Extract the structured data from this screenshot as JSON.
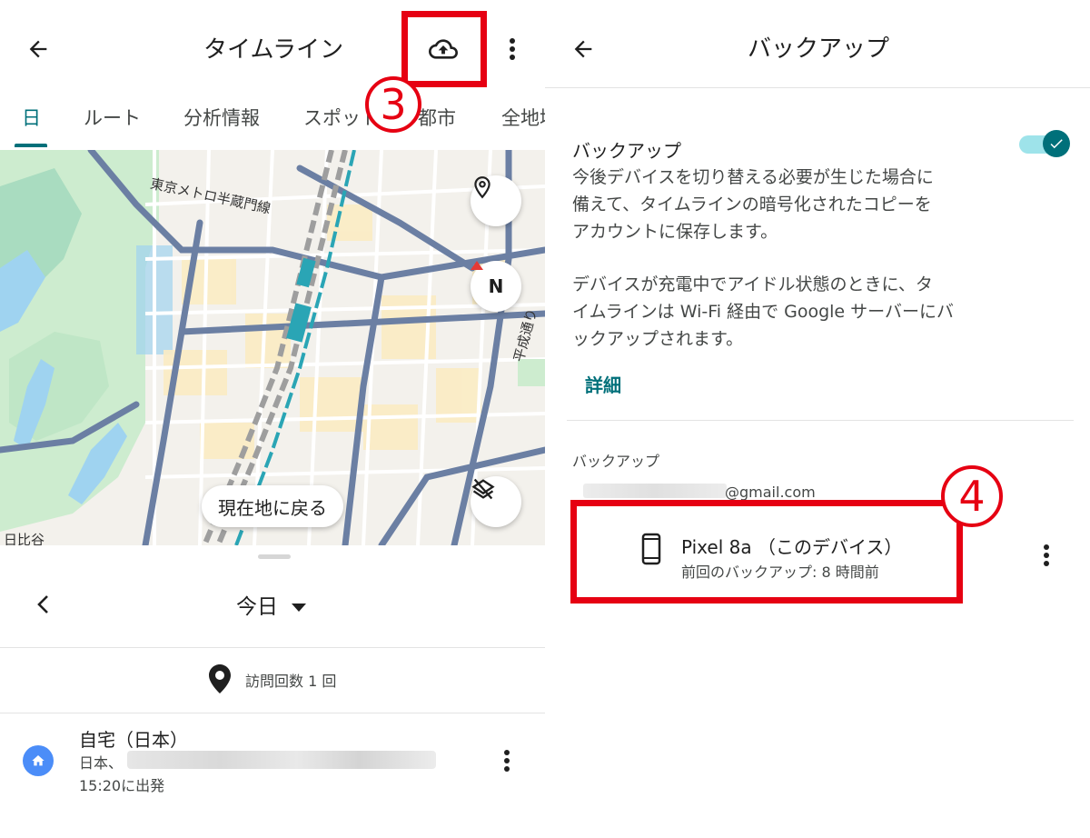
{
  "left": {
    "title": "タイムライン",
    "tabs": [
      "日",
      "ルート",
      "分析情報",
      "スポット",
      "都市",
      "全地域"
    ],
    "map": {
      "line_label": "東京メトロ半蔵門線",
      "street_label": "平成通り",
      "corner_label": "日比谷",
      "return_button": "現在地に戻る",
      "compass_letter": "N"
    },
    "sheet": {
      "date": "今日",
      "visits": "訪問回数 1 回",
      "place": {
        "name": "自宅（日本）",
        "address": "日本、",
        "time": "15:20に出発"
      }
    },
    "callout_number": "3"
  },
  "right": {
    "title": "バックアップ",
    "section_title": "バックアップ",
    "para1": [
      "今後デバイスを切り替える必要が生じた場合に",
      "備えて、タイムラインの暗号化されたコピーを",
      "アカウントに保存します。"
    ],
    "para2": [
      "デバイスが充電中でアイドル状態のときに、タ",
      "イムラインは Wi-Fi 経由で Google サーバーにバ",
      "ックアップされます。"
    ],
    "link": "詳細",
    "backup_subtitle": "バックアップ",
    "email": "@gmail.com",
    "device": {
      "name": "Pixel 8a （このデバイス）",
      "last_backup": "前回のバックアップ: 8 時間前"
    },
    "toggle_on": true,
    "callout_number": "4"
  },
  "colors": {
    "accent": "#00707a",
    "callout_red": "#e60012",
    "home_blue": "#4b8df8"
  }
}
